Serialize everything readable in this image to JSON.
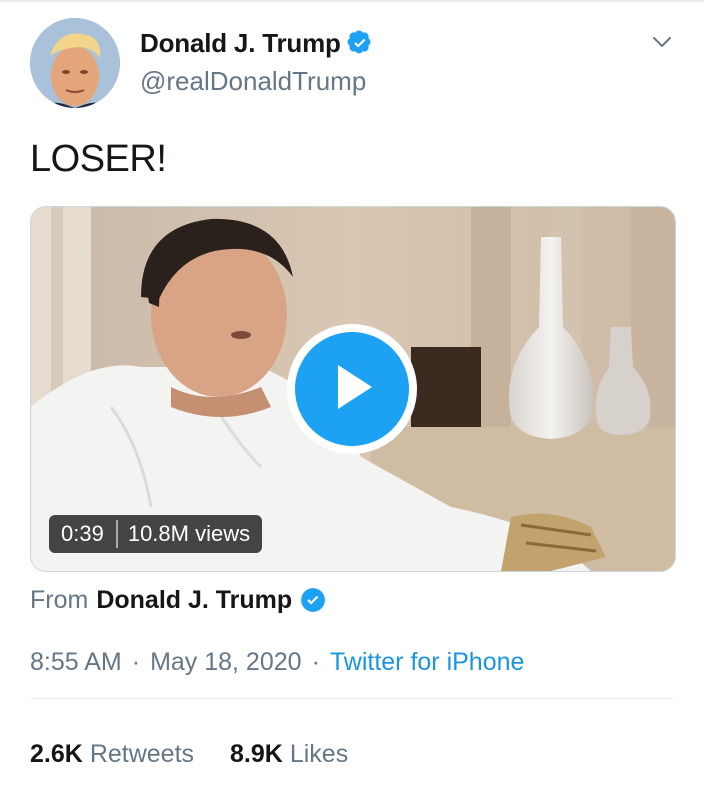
{
  "tweet": {
    "author": {
      "display_name": "Donald J. Trump",
      "handle": "@realDonaldTrump",
      "verified_icon": "verified-badge-icon",
      "avatar": "profile-photo"
    },
    "text": "LOSER!",
    "media": {
      "duration": "0:39",
      "views": "10.8M views",
      "play_icon": "play-icon"
    },
    "attribution": {
      "from_label": "From",
      "name": "Donald J. Trump"
    },
    "meta": {
      "time": "8:55 AM",
      "date": "May 18, 2020",
      "separator": "·",
      "source": "Twitter for iPhone"
    },
    "stats": {
      "retweets_count": "2.6K",
      "retweets_label": "Retweets",
      "likes_count": "8.9K",
      "likes_label": "Likes"
    }
  },
  "colors": {
    "accent": "#1da1f2",
    "link": "#1b95e0",
    "secondary_text": "#657786",
    "primary_text": "#14171a"
  }
}
